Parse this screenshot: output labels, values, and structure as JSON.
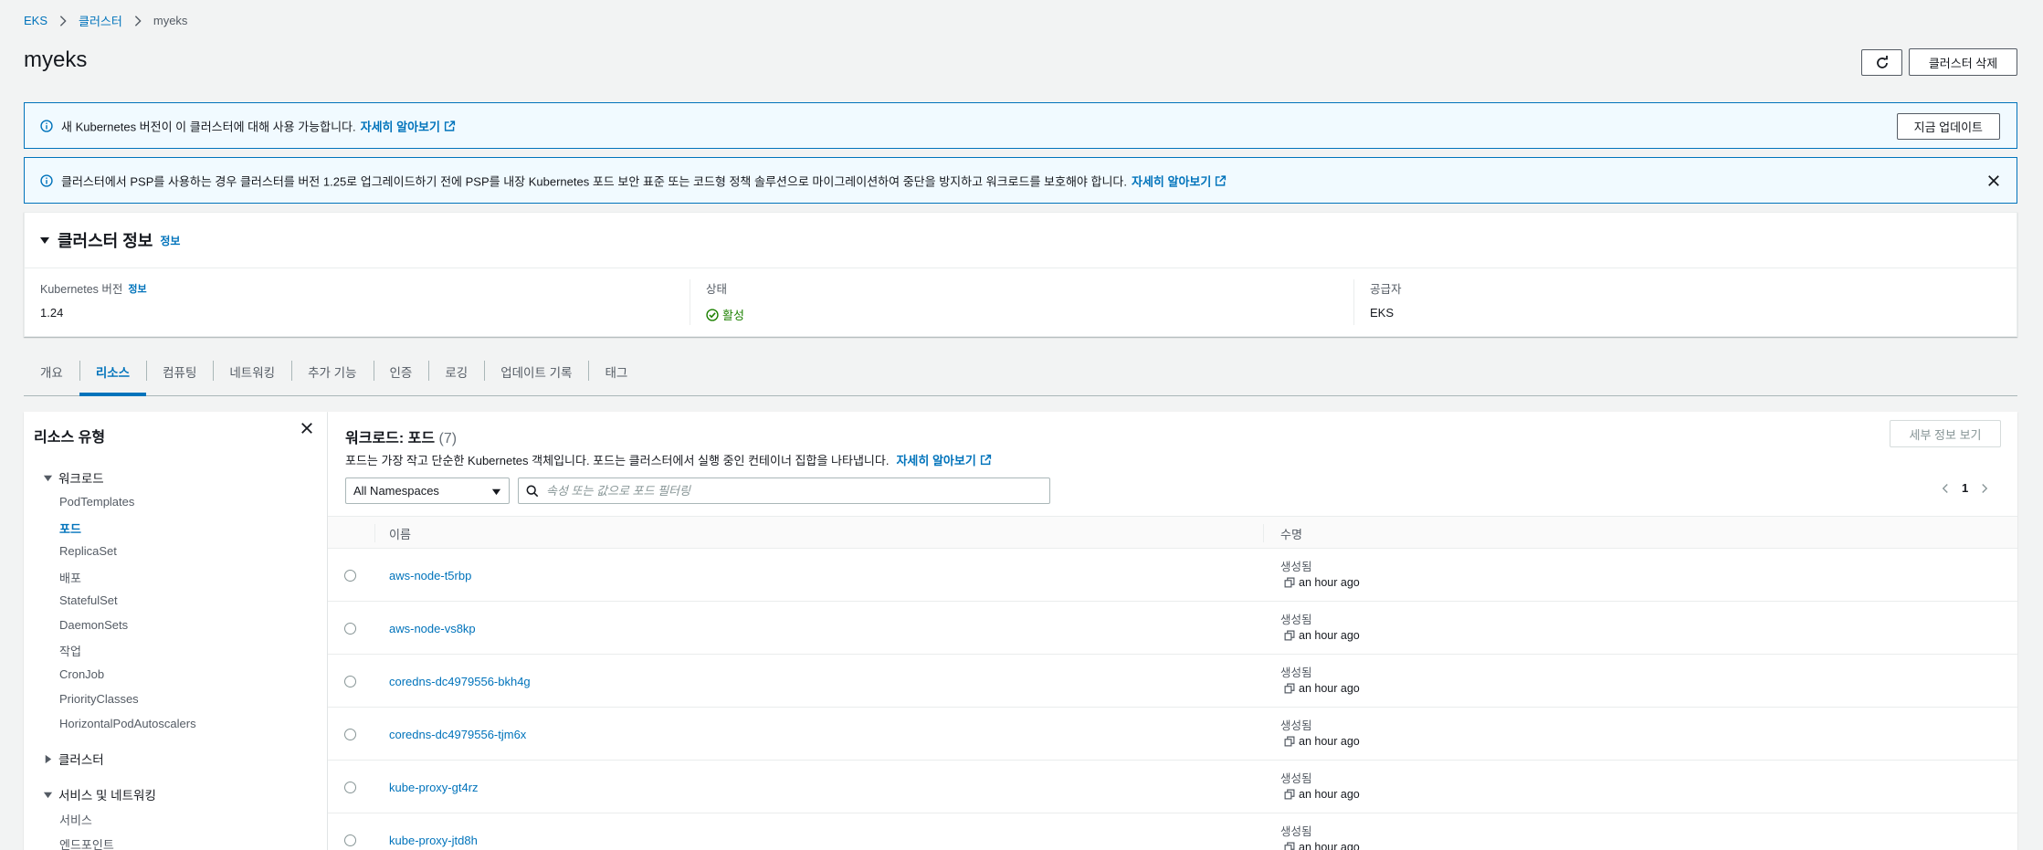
{
  "breadcrumb": {
    "items": [
      "EKS",
      "클러스터"
    ],
    "current": "myeks"
  },
  "page": {
    "title": "myeks"
  },
  "actions": {
    "delete_label": "클러스터 삭제"
  },
  "alerts": [
    {
      "message": "새 Kubernetes 버전이 이 클러스터에 대해 사용 가능합니다.",
      "link": "자세히 알아보기",
      "button": "지금 업데이트"
    },
    {
      "message": "클러스터에서 PSP를 사용하는 경우 클러스터를 버전 1.25로 업그레이드하기 전에 PSP를 내장 Kubernetes 포드 보안 표준 또는 코드형 정책 솔루션으로 마이그레이션하여 중단을 방지하고 워크로드를 보호해야 합니다.",
      "link": "자세히 알아보기"
    }
  ],
  "cluster_info": {
    "title": "클러스터 정보",
    "info_label": "정보",
    "k8s_version_label": "Kubernetes 버전",
    "k8s_version": "1.24",
    "status_label": "상태",
    "status": "활성",
    "provider_label": "공급자",
    "provider": "EKS"
  },
  "tabs": [
    "개요",
    "리소스",
    "컴퓨팅",
    "네트워킹",
    "추가 기능",
    "인증",
    "로깅",
    "업데이트 기록",
    "태그"
  ],
  "active_tab": "리소스",
  "resource_types": {
    "title": "리소스 유형",
    "groups": [
      {
        "label": "워크로드",
        "expanded": true,
        "items": [
          "PodTemplates",
          "포드",
          "ReplicaSet",
          "배포",
          "StatefulSet",
          "DaemonSets",
          "작업",
          "CronJob",
          "PriorityClasses",
          "HorizontalPodAutoscalers"
        ]
      },
      {
        "label": "클러스터",
        "expanded": false
      },
      {
        "label": "서비스 및 네트워킹",
        "expanded": true,
        "items": [
          "서비스",
          "엔드포인트"
        ]
      }
    ],
    "active_item": "포드"
  },
  "workload": {
    "title": "워크로드: 포드",
    "count": "(7)",
    "description": "포드는 가장 작고 단순한 Kubernetes 객체입니다. 포드는 클러스터에서 실행 중인 컨테이너 집합을 나타냅니다.",
    "link": "자세히 알아보기",
    "detail_button": "세부 정보 보기",
    "namespace": "All Namespaces",
    "search_placeholder": "속성 또는 값으로 포드 필터링",
    "page": "1",
    "columns": {
      "name": "이름",
      "age": "수명"
    },
    "rows": [
      {
        "name": "aws-node-t5rbp",
        "age_label": "생성됨",
        "age": "an hour ago"
      },
      {
        "name": "aws-node-vs8kp",
        "age_label": "생성됨",
        "age": "an hour ago"
      },
      {
        "name": "coredns-dc4979556-bkh4g",
        "age_label": "생성됨",
        "age": "an hour ago"
      },
      {
        "name": "coredns-dc4979556-tjm6x",
        "age_label": "생성됨",
        "age": "an hour ago"
      },
      {
        "name": "kube-proxy-gt4rz",
        "age_label": "생성됨",
        "age": "an hour ago"
      },
      {
        "name": "kube-proxy-jtd8h",
        "age_label": "생성됨",
        "age": "an hour ago"
      }
    ]
  },
  "colors": {
    "link": "#0073bb",
    "success": "#1d8102",
    "alert_bg": "#f1faff"
  }
}
